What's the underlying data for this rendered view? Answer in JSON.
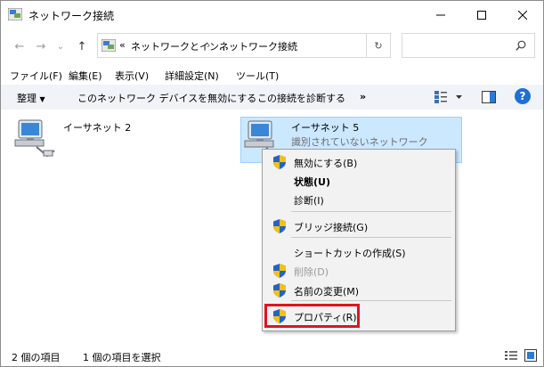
{
  "window": {
    "title": "ネットワーク接続"
  },
  "nav": {
    "back_label": "←",
    "forward_label": "→",
    "dropdown_label": "⌄",
    "up_label": "↑"
  },
  "address": {
    "prefix": "«",
    "crumbs": [
      "ネットワークとイン...",
      "ネットワーク接続"
    ],
    "separator": "›",
    "refresh_label": "↻"
  },
  "search": {
    "placeholder": "",
    "icon": "search-icon"
  },
  "menubar": {
    "items": [
      "ファイル(F)",
      "編集(E)",
      "表示(V)",
      "詳細設定(N)",
      "ツール(T)"
    ]
  },
  "commandbar": {
    "organize": "整理",
    "disable_device": "このネットワーク デバイスを無効にする",
    "diagnose": "この接続を診断する",
    "more": "»",
    "help": "?"
  },
  "items": [
    {
      "name": "イーサネット 2",
      "status": ""
    },
    {
      "name": "イーサネット 5",
      "status": "識別されていないネットワーク",
      "selected": true
    }
  ],
  "context_menu": {
    "items": [
      {
        "label": "無効にする(B)",
        "shield": true,
        "bold": false,
        "disabled": false
      },
      {
        "label": "状態(U)",
        "shield": false,
        "bold": true,
        "disabled": false
      },
      {
        "label": "診断(I)",
        "shield": false,
        "bold": false,
        "disabled": false
      },
      {
        "label": "ブリッジ接続(G)",
        "shield": true,
        "bold": false,
        "disabled": false
      },
      {
        "label": "ショートカットの作成(S)",
        "shield": false,
        "bold": false,
        "disabled": false
      },
      {
        "label": "削除(D)",
        "shield": true,
        "bold": false,
        "disabled": true
      },
      {
        "label": "名前の変更(M)",
        "shield": true,
        "bold": false,
        "disabled": false
      },
      {
        "label": "プロパティ(R)",
        "shield": true,
        "bold": false,
        "disabled": false,
        "highlighted": true
      }
    ]
  },
  "statusbar": {
    "count": "2 個の項目",
    "selected": "1 個の項目を選択"
  },
  "colors": {
    "selection": "#cce8ff",
    "highlight_border": "#e0141e",
    "help_blue": "#1e6fd9",
    "command_bar": "#f0f4f9"
  }
}
